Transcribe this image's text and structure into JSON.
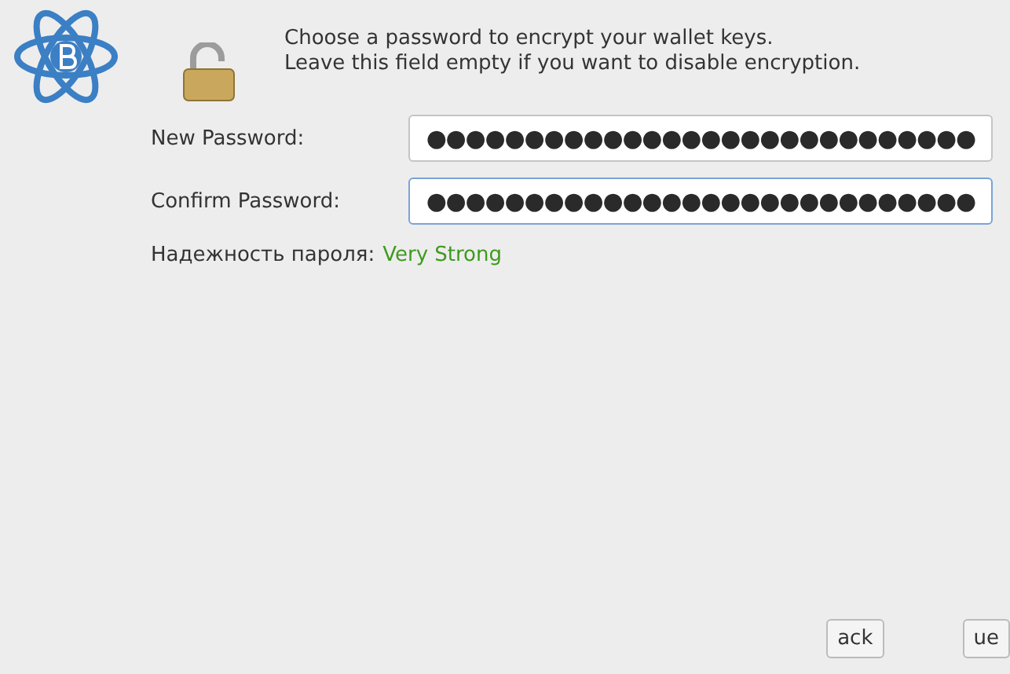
{
  "intro": [
    "Choose a password to encrypt your wallet keys.",
    "Leave this field empty if you want to disable encryption."
  ],
  "fields": [
    {
      "label": "New Password:",
      "value": "●●●●●●●●●●●●●●●●●●●●●●●●●●●●",
      "focused": false
    },
    {
      "label": "Confirm Password:",
      "value": "●●●●●●●●●●●●●●●●●●●●●●●●●●●●",
      "focused": true
    }
  ],
  "strength": {
    "label": "Надежность пароля:",
    "value": "Very Strong",
    "color": "#3e9a1c"
  },
  "buttons": [
    "ack",
    "ue"
  ]
}
